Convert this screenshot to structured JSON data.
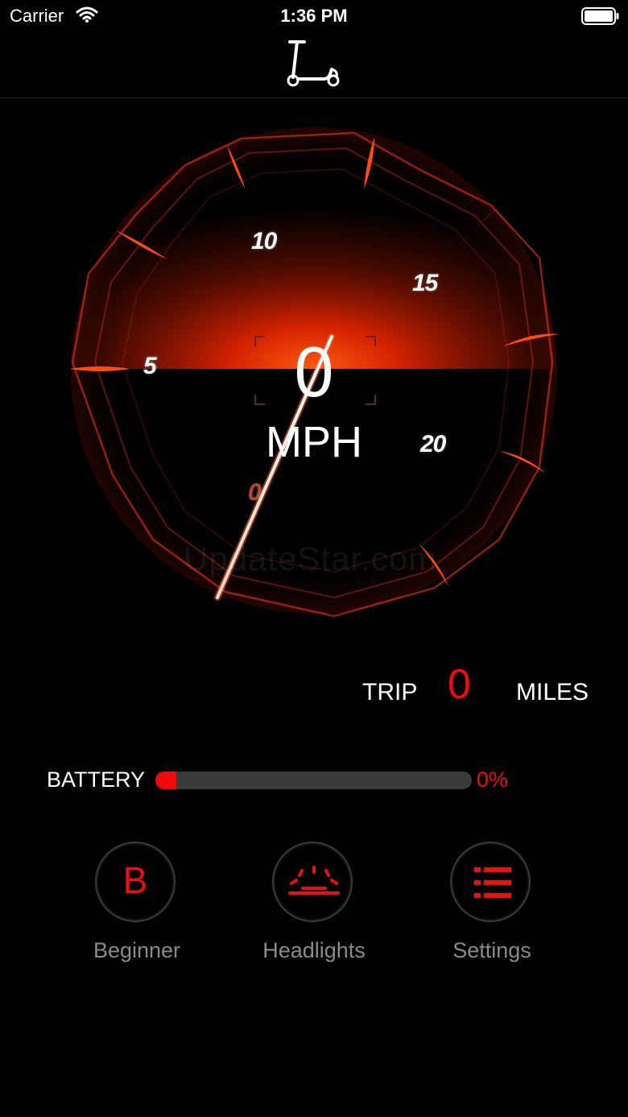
{
  "status_bar": {
    "carrier": "Carrier",
    "time": "1:36 PM"
  },
  "nav": {
    "icon": "scooter-icon"
  },
  "gauge": {
    "tick_labels": [
      "0",
      "5",
      "10",
      "15",
      "20"
    ],
    "speed": "0",
    "unit": "MPH",
    "watermark": "UpdateStar.com",
    "accent_color": "#ff3a00"
  },
  "trip": {
    "label": "TRIP",
    "value": "0",
    "unit": "MILES"
  },
  "battery": {
    "label": "BATTERY",
    "percent_text": "0%",
    "level": 0
  },
  "modes": [
    {
      "label": "Beginner",
      "icon": "B"
    },
    {
      "label": "Headlights",
      "icon": "headlight-icon"
    },
    {
      "label": "Settings",
      "icon": "list-icon"
    }
  ],
  "colors": {
    "accent_red": "#f00a0a",
    "background": "#000000",
    "muted_label": "#8a8a8a"
  }
}
